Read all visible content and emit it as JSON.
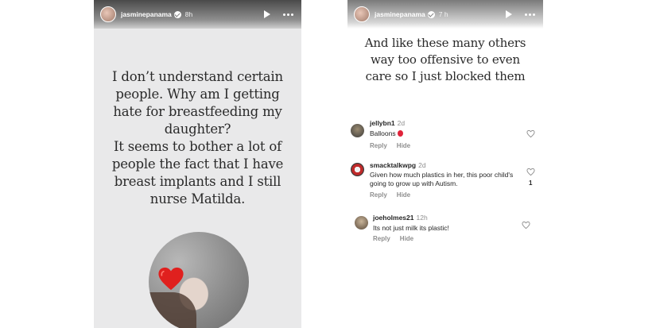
{
  "left_story": {
    "username": "jasminepanama",
    "time": "8h",
    "lines": [
      "I don’t understand certain",
      "people. Why am I getting",
      "hate for breastfeeding my",
      "daughter?",
      "It seems to bother a lot of",
      "people the fact that I have",
      "breast implants and I still",
      "nurse Matilda."
    ],
    "sticker": "heart-icon"
  },
  "right_story": {
    "username": "jasminepanama",
    "time": "7 h",
    "lines": [
      "And like these many others",
      "way too offensive to even",
      "care so I just blocked them"
    ],
    "comments": [
      {
        "user": "jellybn1",
        "age": "2d",
        "text": "Balloons",
        "reply": "Reply",
        "hide": "Hide",
        "likes": ""
      },
      {
        "user": "smacktalkwpg",
        "age": "2d",
        "text": "Given how much plastics in her, this poor child's going to grow up with Autism.",
        "reply": "Reply",
        "hide": "Hide",
        "likes": "1"
      },
      {
        "user": "joeholmes21",
        "age": "12h",
        "text": "Its not just milk its plastic!",
        "reply": "Reply",
        "hide": "Hide",
        "likes": ""
      }
    ]
  },
  "colors": {
    "left_background": "#e9e9ea",
    "text": "#2a2a2a",
    "heart": "#e0201e",
    "secondary_text": "#8e8e8e"
  }
}
